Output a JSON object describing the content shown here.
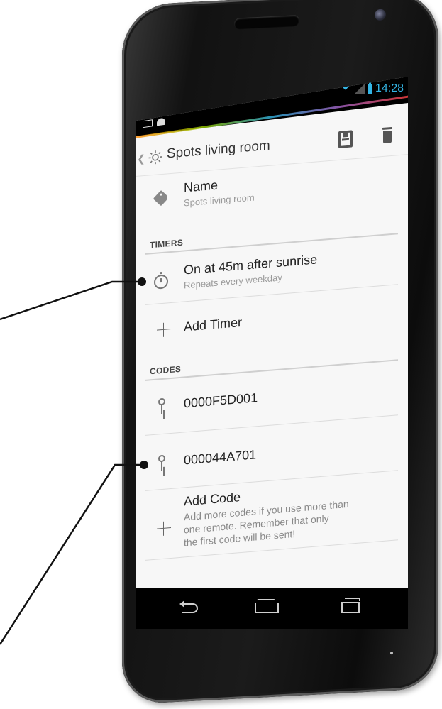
{
  "status_bar": {
    "time": "14:28",
    "icons": [
      "gmail-icon",
      "android-icon",
      "wifi-icon",
      "signal-icon",
      "battery-icon"
    ]
  },
  "action_bar": {
    "title": "Spots living room",
    "icons": [
      "back-chevron-icon",
      "sun-icon",
      "save-icon",
      "trash-icon"
    ]
  },
  "name_row": {
    "label": "Name",
    "value": "Spots living room"
  },
  "timers": {
    "header": "TIMERS",
    "items": [
      {
        "label": "On at 45m after sunrise",
        "sub": "Repeats every weekday"
      }
    ],
    "add_label": "Add Timer"
  },
  "codes": {
    "header": "CODES",
    "items": [
      {
        "label": "0000F5D001"
      },
      {
        "label": "000044A701"
      }
    ],
    "add_label": "Add Code",
    "add_help_lines": [
      "Add more codes if you use more than",
      "one remote. Remember that only",
      "the first code will be sent!"
    ]
  },
  "colors": {
    "accent": "#33b5e5",
    "screen_bg": "#f7f7f7",
    "phone_body": "#121212"
  }
}
